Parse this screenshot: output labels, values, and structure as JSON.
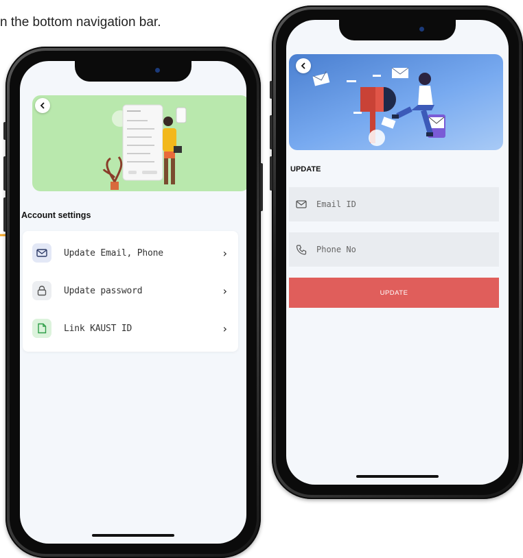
{
  "caption": "n the bottom navigation bar.",
  "colors": {
    "accent_red": "#e05e5b",
    "hero_green": "#b9e8ad",
    "hero_blue": "#5b8fd8",
    "pointer_orange": "#f5a623"
  },
  "screen_account": {
    "section_title": "Account settings",
    "items": [
      {
        "label": "Update Email, Phone",
        "icon": "mail-icon"
      },
      {
        "label": "Update password",
        "icon": "lock-icon"
      },
      {
        "label": "Link KAUST ID",
        "icon": "document-icon"
      }
    ],
    "chevron": "›"
  },
  "screen_update": {
    "title": "UPDATE",
    "email_placeholder": "Email ID",
    "phone_placeholder": "Phone No",
    "button_label": "UPDATE"
  }
}
